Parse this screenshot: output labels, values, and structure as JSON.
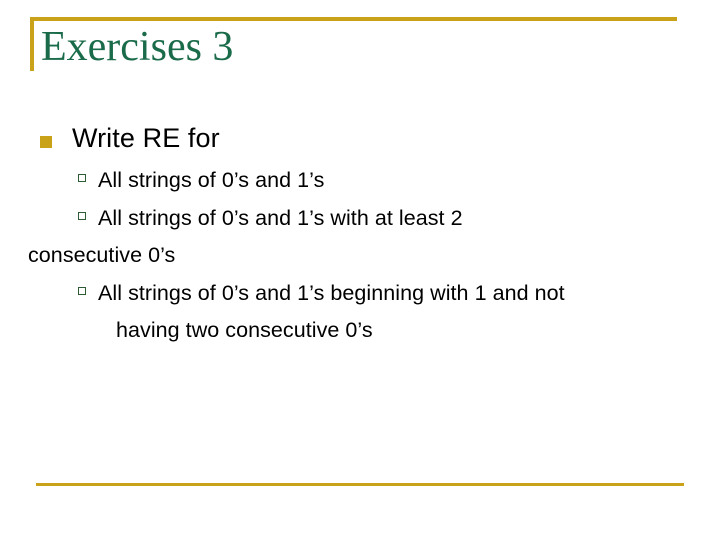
{
  "slide": {
    "title": "Exercises 3",
    "title_color": "#1a6b4a",
    "accent_color": "#c9a21a",
    "bullet_outline_color": "#2c5c34",
    "background_color": "#ffffff",
    "text_color": "#000000"
  },
  "content": {
    "level1": {
      "text": "Write RE for",
      "bullet_glyph": "filled-square"
    },
    "items": [
      {
        "bullet_glyph": "hollow-square",
        "line1": "All strings of 0’s and 1’s",
        "line2": ""
      },
      {
        "bullet_glyph": "hollow-square",
        "line1": "All strings of 0’s and 1’s with at least 2",
        "line2": "consecutive 0’s"
      },
      {
        "bullet_glyph": "hollow-square",
        "line1": "All strings of 0’s and 1’s beginning with 1 and not",
        "line2": "having two consecutive 0’s"
      }
    ]
  }
}
